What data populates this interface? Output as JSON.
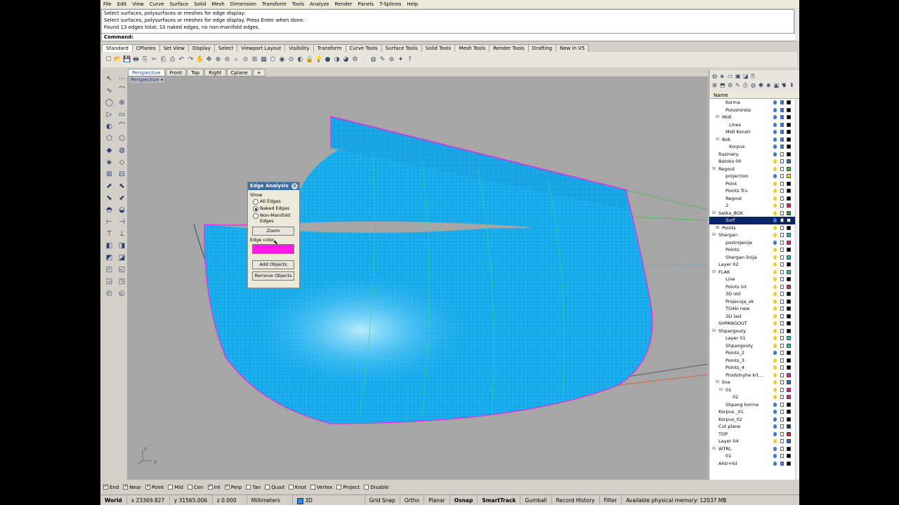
{
  "menu": [
    "File",
    "Edit",
    "View",
    "Curve",
    "Surface",
    "Solid",
    "Mesh",
    "Dimension",
    "Transform",
    "Tools",
    "Analyze",
    "Render",
    "Panels",
    "T-Splines",
    "Help"
  ],
  "command_history": [
    "Select surfaces, polysurfaces or meshes for edge display:",
    "Select surfaces, polysurfaces or meshes for edge display. Press Enter when done:",
    "Found 13 edges total; 10 naked edges, no non-manifold edges."
  ],
  "command_prompt": "Command:",
  "toolbar_tabs": [
    "Standard",
    "CPlanes",
    "Set View",
    "Display",
    "Select",
    "Viewport Layout",
    "Visibility",
    "Transform",
    "Curve Tools",
    "Surface Tools",
    "Solid Tools",
    "Mesh Tools",
    "Render Tools",
    "Drafting",
    "New in V5"
  ],
  "viewport_tabs": [
    "Perspective",
    "Front",
    "Top",
    "Right",
    "Cplane",
    "+"
  ],
  "viewport_label": "Perspective",
  "edge_dialog": {
    "title": "Edge Analysis",
    "show_label": "Show",
    "options": [
      "All Edges",
      "Naked Edges",
      "Non-Manifold Edges"
    ],
    "selected": "Naked Edges",
    "zoom_button": "Zoom",
    "edge_color_label": "Edge color",
    "edge_color": "#ff18e8",
    "add_button": "Add Objects",
    "remove_button": "Remove Objects"
  },
  "layer_panel": {
    "column_header": "Name",
    "layers": [
      {
        "name": "Korma",
        "indent": 2,
        "tw": "",
        "bulb": "#3a7ad8",
        "locked": true,
        "color": "#000000"
      },
      {
        "name": "Polushirota",
        "indent": 2,
        "tw": "",
        "bulb": "#3a7ad8",
        "locked": true,
        "color": "#000000"
      },
      {
        "name": "Midl",
        "indent": 1,
        "tw": "⊟",
        "bulb": "#3a7ad8",
        "locked": true,
        "color": "#000000"
      },
      {
        "name": "Lines",
        "indent": 3,
        "tw": "",
        "bulb": "#3a7ad8",
        "locked": true,
        "color": "#000000"
      },
      {
        "name": "Midl Konstr",
        "indent": 2,
        "tw": "",
        "bulb": "#3a7ad8",
        "locked": true,
        "color": "#000000"
      },
      {
        "name": "Bok",
        "indent": 1,
        "tw": "⊟",
        "bulb": "#3a7ad8",
        "locked": true,
        "color": "#000000"
      },
      {
        "name": "Korpus",
        "indent": 3,
        "tw": "",
        "bulb": "#3a7ad8",
        "locked": true,
        "color": "#000000"
      },
      {
        "name": "Razmery",
        "indent": 0,
        "tw": "",
        "bulb": "#3a7ad8",
        "locked": false,
        "color": "#000000"
      },
      {
        "name": "Batoks 00",
        "indent": 0,
        "tw": "",
        "bulb": "#f0d020",
        "locked": false,
        "color": "#2a6ad8"
      },
      {
        "name": "Regout",
        "indent": 0,
        "tw": "⊟",
        "bulb": "#f0d020",
        "locked": false,
        "color": "#40c040"
      },
      {
        "name": "projection",
        "indent": 2,
        "tw": "",
        "bulb": "#3a7ad8",
        "locked": false,
        "color": "#e8e020"
      },
      {
        "name": "Point",
        "indent": 2,
        "tw": "",
        "bulb": "#f0d020",
        "locked": false,
        "color": "#000000"
      },
      {
        "name": "Points Tru",
        "indent": 2,
        "tw": "",
        "bulb": "#f0d020",
        "locked": false,
        "color": "#000000"
      },
      {
        "name": "Regout",
        "indent": 2,
        "tw": "",
        "bulb": "#f0d020",
        "locked": false,
        "color": "#000000"
      },
      {
        "name": "2",
        "indent": 2,
        "tw": "",
        "bulb": "#f0d020",
        "locked": false,
        "color": "#e02070"
      },
      {
        "name": "Setka_BOK",
        "indent": 0,
        "tw": "⊟",
        "bulb": "#f0d020",
        "locked": false,
        "color": "#20a040"
      },
      {
        "name": "Surf",
        "indent": 2,
        "tw": "",
        "bulb": "#3a7ad8",
        "locked": false,
        "color": "#ffffff",
        "selected": true
      },
      {
        "name": "Points",
        "indent": 1,
        "tw": "⊞",
        "bulb": "#f0d020",
        "locked": false,
        "color": "#000000"
      },
      {
        "name": "Shergan",
        "indent": 0,
        "tw": "⊟",
        "bulb": "#f0d020",
        "locked": false,
        "color": "#20c0c0"
      },
      {
        "name": "postrojenije",
        "indent": 2,
        "tw": "",
        "bulb": "#3a7ad8",
        "locked": false,
        "color": "#e02090"
      },
      {
        "name": "Points",
        "indent": 2,
        "tw": "",
        "bulb": "#f0d020",
        "locked": false,
        "color": "#000000"
      },
      {
        "name": "Shergan linija",
        "indent": 2,
        "tw": "",
        "bulb": "#f0d020",
        "locked": false,
        "color": "#20c0c0"
      },
      {
        "name": "Layer 02",
        "indent": 0,
        "tw": "",
        "bulb": "#f0d020",
        "locked": false,
        "color": "#000000"
      },
      {
        "name": "FLAK",
        "indent": 0,
        "tw": "⊟",
        "bulb": "#f0d020",
        "locked": false,
        "color": "#20c0c0"
      },
      {
        "name": "Line",
        "indent": 2,
        "tw": "",
        "bulb": "#f0d020",
        "locked": false,
        "color": "#000000"
      },
      {
        "name": "Points int",
        "indent": 2,
        "tw": "",
        "bulb": "#f0d020",
        "locked": false,
        "color": "#e02090"
      },
      {
        "name": "3D old",
        "indent": 2,
        "tw": "",
        "bulb": "#f0d020",
        "locked": false,
        "color": "#000000"
      },
      {
        "name": "Projecoja_ok",
        "indent": 2,
        "tw": "",
        "bulb": "#f0d020",
        "locked": false,
        "color": "#000000"
      },
      {
        "name": "TO4ki new",
        "indent": 2,
        "tw": "",
        "bulb": "#f0d020",
        "locked": false,
        "color": "#000000"
      },
      {
        "name": "3D last",
        "indent": 2,
        "tw": "",
        "bulb": "#f0d020",
        "locked": false,
        "color": "#000000"
      },
      {
        "name": "SHPANGOUT",
        "indent": 0,
        "tw": "",
        "bulb": "#f0d020",
        "locked": false,
        "color": "#000000"
      },
      {
        "name": "Shpangouty",
        "indent": 0,
        "tw": "⊟",
        "bulb": "#f0d020",
        "locked": false,
        "color": "#000000"
      },
      {
        "name": "Layer 01",
        "indent": 2,
        "tw": "",
        "bulb": "#f0d020",
        "locked": false,
        "color": "#20c0c0"
      },
      {
        "name": "Shpangouty",
        "indent": 2,
        "tw": "",
        "bulb": "#f0d020",
        "locked": false,
        "color": "#20c0c0"
      },
      {
        "name": "Points_2",
        "indent": 2,
        "tw": "",
        "bulb": "#3a7ad8",
        "locked": false,
        "color": "#000000"
      },
      {
        "name": "Points_3",
        "indent": 2,
        "tw": "",
        "bulb": "#f0d020",
        "locked": false,
        "color": "#000000"
      },
      {
        "name": "Points_4",
        "indent": 2,
        "tw": "",
        "bulb": "#f0d020",
        "locked": false,
        "color": "#000000"
      },
      {
        "name": "Prodolnyhe krt...",
        "indent": 2,
        "tw": "",
        "bulb": "#f0d020",
        "locked": false,
        "color": "#e02090"
      },
      {
        "name": "line",
        "indent": 1,
        "tw": "⊟",
        "bulb": "#f0d020",
        "locked": false,
        "color": "#2a6ad8"
      },
      {
        "name": "01",
        "indent": 2,
        "tw": "⊟",
        "bulb": "#f0d020",
        "locked": false,
        "color": "#e02090"
      },
      {
        "name": "02",
        "indent": 4,
        "tw": "",
        "bulb": "#f0d020",
        "locked": false,
        "color": "#e02090"
      },
      {
        "name": "Shpang korma",
        "indent": 2,
        "tw": "",
        "bulb": "#3a7ad8",
        "locked": false,
        "color": "#000000"
      },
      {
        "name": "Korpus _01",
        "indent": 0,
        "tw": "",
        "bulb": "#3a7ad8",
        "locked": false,
        "color": "#000000"
      },
      {
        "name": "Korpus_02",
        "indent": 0,
        "tw": "",
        "bulb": "#3a7ad8",
        "locked": false,
        "color": "#000000"
      },
      {
        "name": "Cut plane",
        "indent": 0,
        "tw": "",
        "bulb": "#3a7ad8",
        "locked": false,
        "color": "#1a2a8a"
      },
      {
        "name": "TOP",
        "indent": 0,
        "tw": "",
        "bulb": "#3a7ad8",
        "locked": false,
        "color": "#e02020"
      },
      {
        "name": "Layer 04",
        "indent": 0,
        "tw": "",
        "bulb": "#f0d020",
        "locked": false,
        "color": "#2a6ad8"
      },
      {
        "name": "WTRL",
        "indent": 0,
        "tw": "⊟",
        "bulb": "#3a7ad8",
        "locked": false,
        "color": "#000000"
      },
      {
        "name": "01",
        "indent": 2,
        "tw": "",
        "bulb": "#3a7ad8",
        "locked": false,
        "color": "#000000"
      },
      {
        "name": "Ahtr+kil",
        "indent": 0,
        "tw": "",
        "bulb": "#3a7ad8",
        "locked": true,
        "color": "#000000"
      }
    ]
  },
  "osnap": [
    {
      "label": "End",
      "checked": true
    },
    {
      "label": "Near",
      "checked": true
    },
    {
      "label": "Point",
      "checked": true
    },
    {
      "label": "Mid",
      "checked": false
    },
    {
      "label": "Cen",
      "checked": false
    },
    {
      "label": "Int",
      "checked": true
    },
    {
      "label": "Perp",
      "checked": true
    },
    {
      "label": "Tan",
      "checked": false
    },
    {
      "label": "Quad",
      "checked": false
    },
    {
      "label": "Knot",
      "checked": false
    },
    {
      "label": "Vertex",
      "checked": false
    },
    {
      "label": "Project",
      "checked": false
    },
    {
      "label": "Disable",
      "checked": false
    }
  ],
  "status": {
    "cplane": "World",
    "x": "x 23369.827",
    "y": "y 31565.006",
    "z": "z 0.000",
    "units": "Millimeters",
    "layer": "3D",
    "grid_snap": "Grid Snap",
    "ortho": "Ortho",
    "planar": "Planar",
    "osnap": "Osnap",
    "smarttrack": "SmartTrack",
    "gumball": "Gumball",
    "record_history": "Record History",
    "filter": "Filter",
    "memory": "Available physical memory: 12037 MB"
  },
  "axis_labels": {
    "z": "z",
    "y": "y"
  }
}
